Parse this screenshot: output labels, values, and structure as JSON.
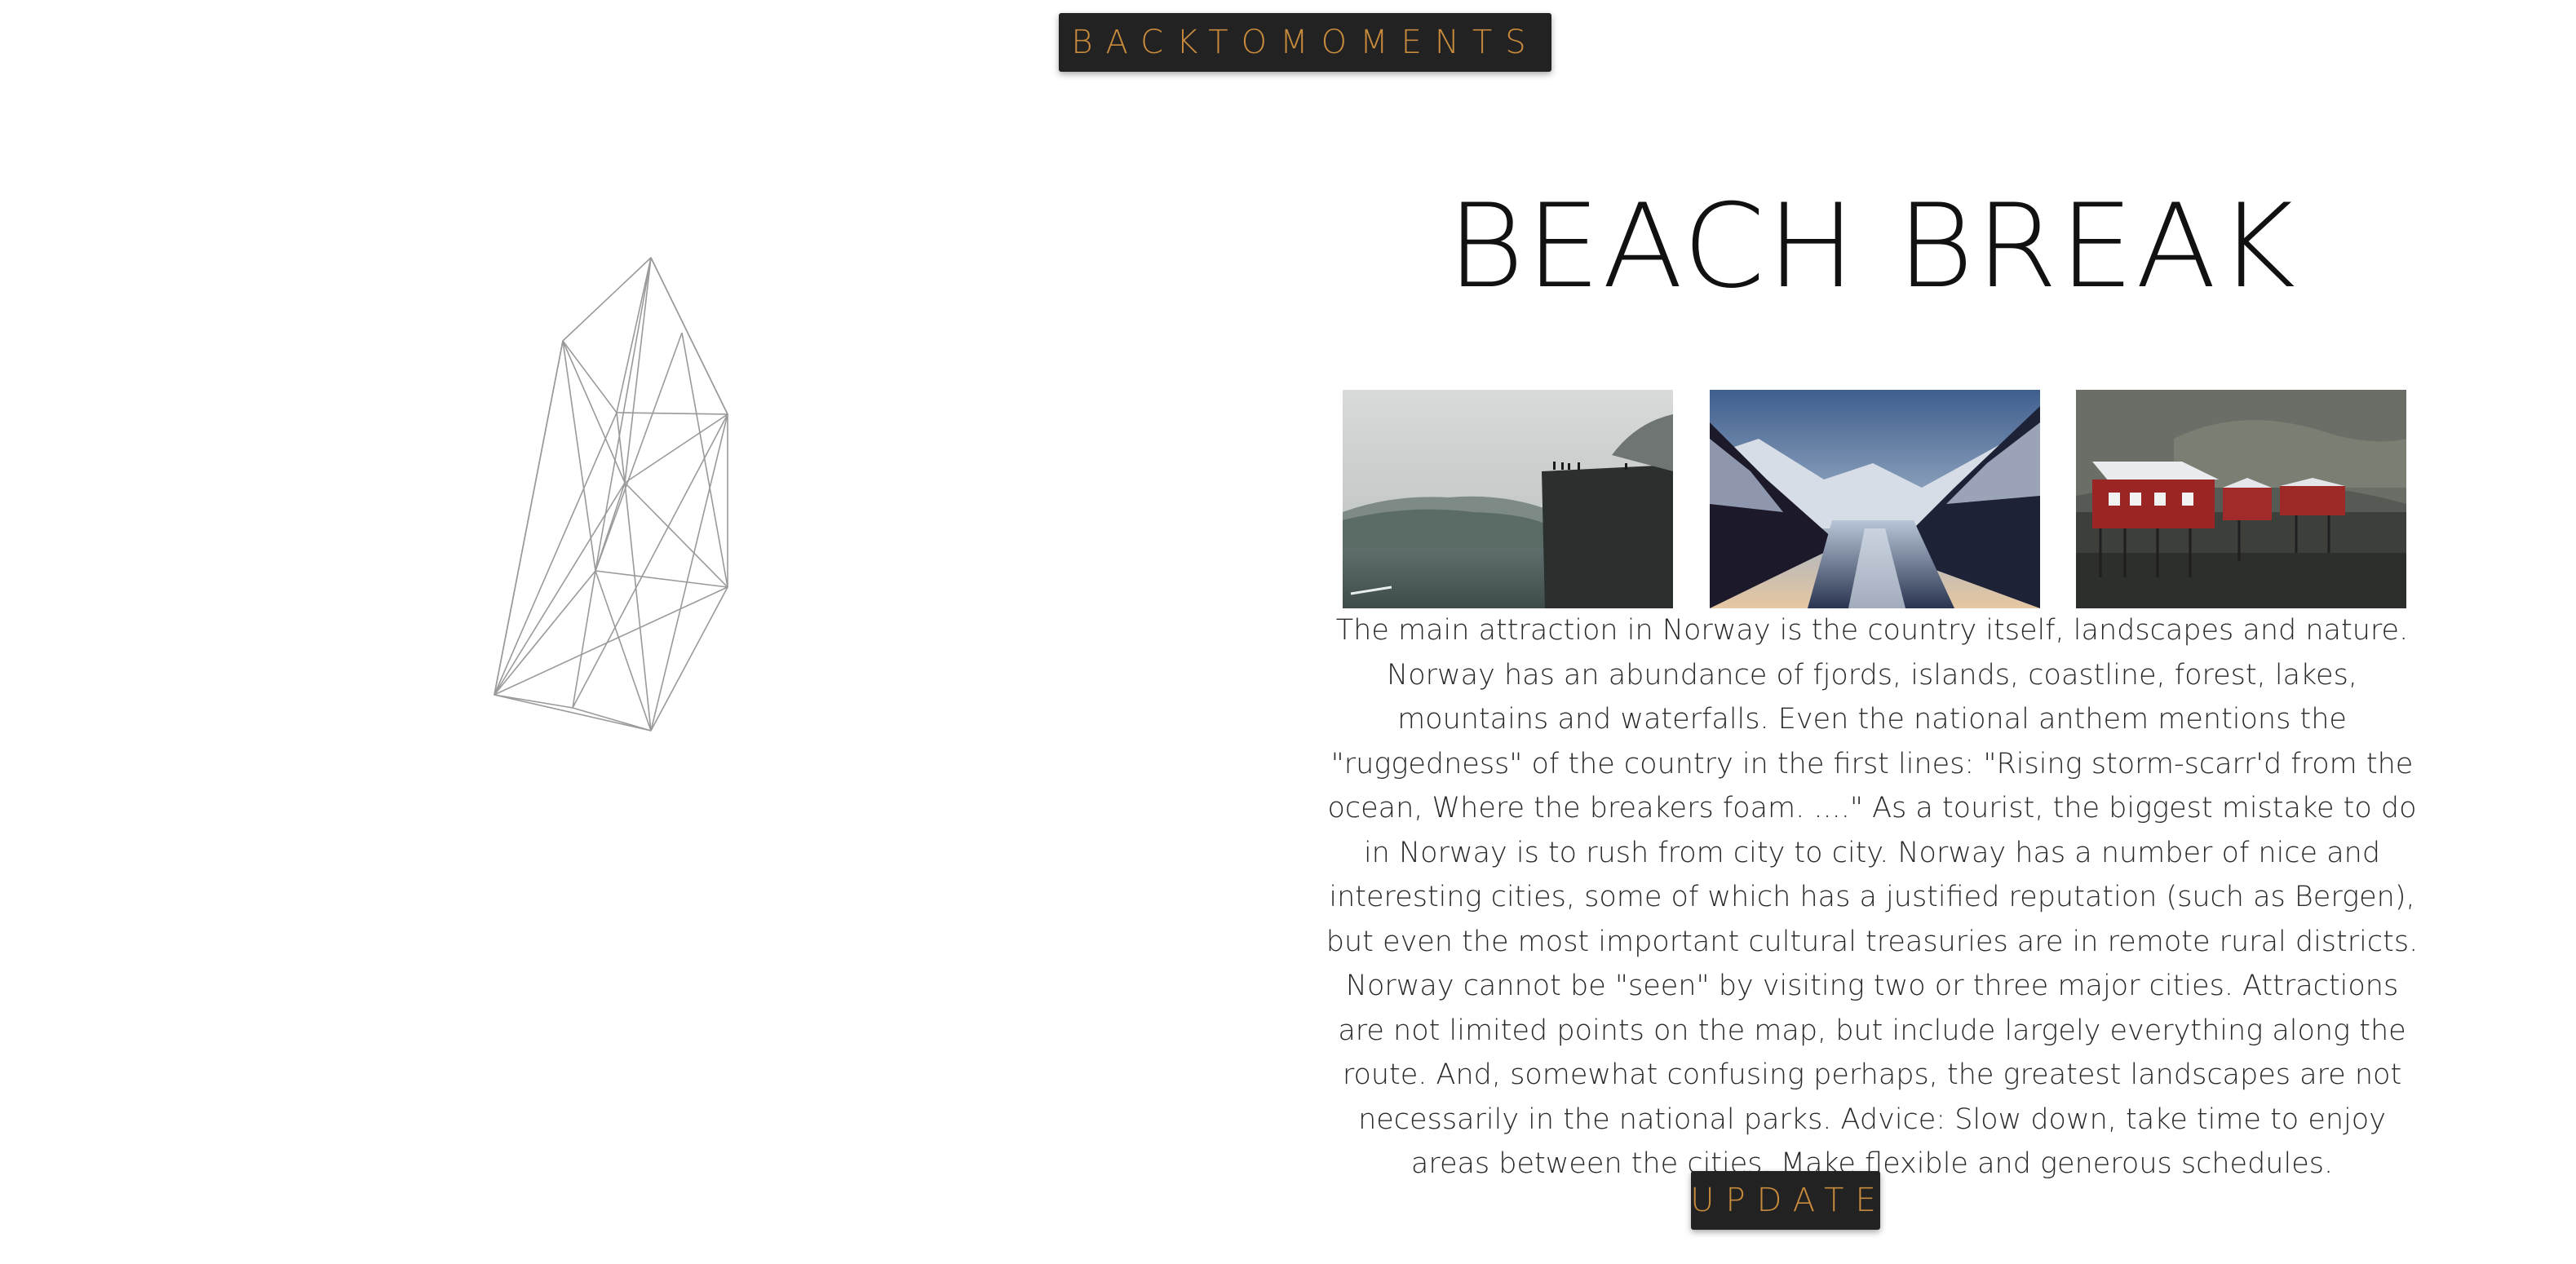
{
  "nav": {
    "back_label": "BACKTOMOMENTS"
  },
  "post": {
    "title": "BEACH BREAK",
    "body": "The main attraction in Norway is the country itself, landscapes and nature. Norway has an abundance of fjords, islands, coastline, forest, lakes, mountains and waterfalls. Even the national anthem mentions the \"ruggedness\" of the country in the first lines: \"Rising storm-scarr'd from the ocean, Where the breakers foam. ....\" As a tourist, the biggest mistake to do in Norway is to rush from city to city. Norway has a number of nice and interesting cities, some of which has a justified reputation (such as Bergen), but even the most important cultural treasuries are in remote rural districts. Norway cannot be \"seen\" by visiting two or three major cities. Attractions are not limited points on the map, but include largely everything along the route. And, somewhat confusing perhaps, the greatest landscapes are not necessarily in the national parks. Advice: Slow down, take time to enjoy areas between the cities. Make flexible and generous schedules."
  },
  "gallery": {
    "photos": [
      {
        "name": "cliff-over-fjord-photo"
      },
      {
        "name": "fjord-mountains-photo"
      },
      {
        "name": "red-fishing-cabins-photo"
      }
    ]
  },
  "actions": {
    "update_label": "UPDATE"
  },
  "colors": {
    "button_bg": "#222222",
    "button_text": "#c88a3c",
    "text": "#2a2a2a"
  }
}
